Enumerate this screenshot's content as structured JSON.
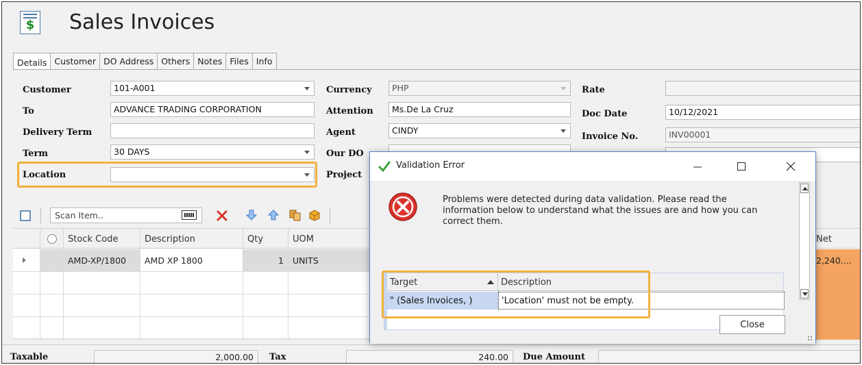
{
  "window": {
    "title": "Sales Invoices"
  },
  "tabs": [
    "Details",
    "Customer",
    "DO Address",
    "Others",
    "Notes",
    "Files",
    "Info"
  ],
  "form": {
    "customer_label": "Customer",
    "customer_value": "101-A001",
    "to_label": "To",
    "to_value": "ADVANCE TRADING CORPORATION",
    "delivery_term_label": "Delivery Term",
    "delivery_term_value": "",
    "term_label": "Term",
    "term_value": "30 DAYS",
    "location_label": "Location",
    "location_value": "",
    "currency_label": "Currency",
    "currency_value": "PHP",
    "attention_label": "Attention",
    "attention_value": "Ms.De La Cruz",
    "agent_label": "Agent",
    "agent_value": "CINDY",
    "our_do_label": "Our DO",
    "project_label": "Project",
    "rate_label": "Rate",
    "rate_value": "",
    "doc_date_label": "Doc Date",
    "doc_date_value": "10/12/2021",
    "invoice_no_label": "Invoice No.",
    "invoice_no_value": "INV00001"
  },
  "toolbar": {
    "scan_placeholder": "Scan Item.."
  },
  "grid": {
    "headers": [
      "Stock Code",
      "Description",
      "Qty",
      "UOM",
      "Net"
    ],
    "rows": [
      {
        "stock_code": "AMD-XP/1800",
        "description": "AMD XP 1800",
        "qty": "1",
        "uom": "UNITS",
        "net": "2,240...."
      }
    ]
  },
  "footer": {
    "taxable_label": "Taxable",
    "taxable_value": "2,000.00",
    "tax_label": "Tax",
    "tax_value": "240.00",
    "due_label": "Due Amount",
    "due_value": ""
  },
  "dialog": {
    "title": "Validation Error",
    "message": "Problems were detected during data validation. Please read the information below to understand what the issues are and how you can correct them.",
    "columns": [
      "Target",
      "Description"
    ],
    "rows": [
      {
        "target": "\" (Sales Invoices, )",
        "description": "'Location' must not be empty."
      }
    ],
    "close_label": "Close"
  },
  "colors": {
    "highlight": "#f0b23c",
    "selection": "#c8d8f2",
    "net_column": "#f4a460",
    "error_red": "#d9332b"
  }
}
